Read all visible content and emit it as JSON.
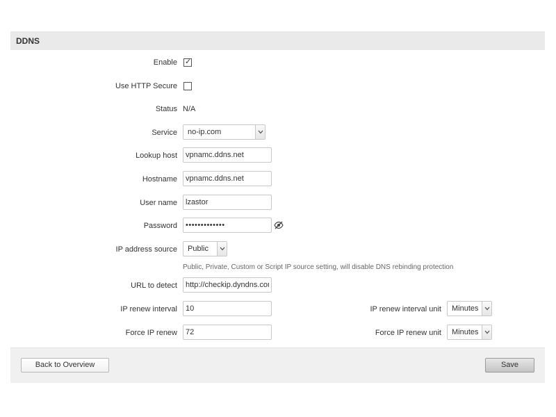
{
  "panel": {
    "title": "DDNS"
  },
  "form": {
    "enable": {
      "label": "Enable",
      "checked": true
    },
    "use_https": {
      "label": "Use HTTP Secure",
      "checked": false
    },
    "status": {
      "label": "Status",
      "value": "N/A"
    },
    "service": {
      "label": "Service",
      "value": "no-ip.com"
    },
    "lookup_host": {
      "label": "Lookup host",
      "value": "vpnamc.ddns.net"
    },
    "hostname": {
      "label": "Hostname",
      "value": "vpnamc.ddns.net"
    },
    "username": {
      "label": "User name",
      "value": "lzastor"
    },
    "password": {
      "label": "Password",
      "value": "•••••••••••••"
    },
    "ip_source": {
      "label": "IP address source",
      "value": "Public",
      "hint": "Public, Private, Custom or Script IP source setting, will disable DNS rebinding protection"
    },
    "url_detect": {
      "label": "URL to detect",
      "value": "http://checkip.dyndns.con"
    },
    "ip_renew_interval": {
      "label": "IP renew interval",
      "value": "10"
    },
    "ip_renew_interval_unit": {
      "label": "IP renew interval unit",
      "value": "Minutes"
    },
    "force_ip_renew": {
      "label": "Force IP renew",
      "value": "72"
    },
    "force_ip_renew_unit": {
      "label": "Force IP renew unit",
      "value": "Minutes"
    }
  },
  "footer": {
    "back_label": "Back to Overview",
    "save_label": "Save"
  },
  "icons": {
    "password_toggle": "eye-slash-icon",
    "dropdown": "chevron-down-icon"
  }
}
